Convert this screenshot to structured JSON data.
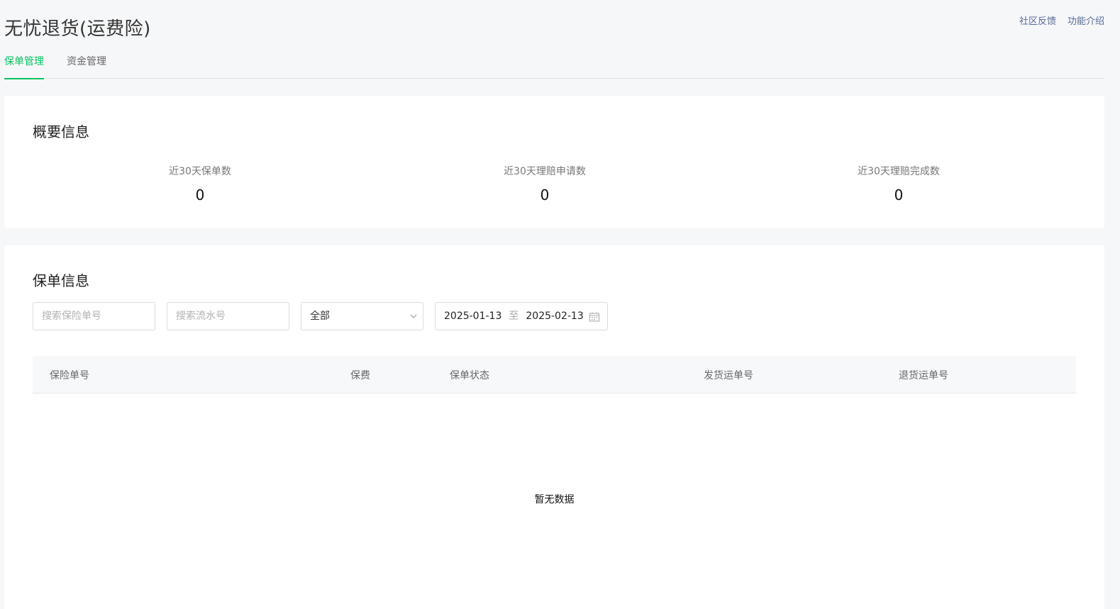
{
  "header": {
    "title": "无忧退货(运费险)",
    "links": [
      "社区反馈",
      "功能介绍"
    ]
  },
  "tabs": [
    {
      "label": "保单管理",
      "active": true
    },
    {
      "label": "资金管理",
      "active": false
    }
  ],
  "overview": {
    "title": "概要信息",
    "stats": [
      {
        "label": "近30天保单数",
        "value": "0"
      },
      {
        "label": "近30天理赔申请数",
        "value": "0"
      },
      {
        "label": "近30天理赔完成数",
        "value": "0"
      }
    ]
  },
  "policy": {
    "title": "保单信息",
    "filters": {
      "policy_no_placeholder": "搜索保险单号",
      "serial_no_placeholder": "搜索流水号",
      "status_selected": "全部",
      "date_start": "2025-01-13",
      "date_sep": "至",
      "date_end": "2025-02-13"
    },
    "table": {
      "columns": [
        "保险单号",
        "保费",
        "保单状态",
        "发货运单号",
        "退货运单号"
      ],
      "rows": [],
      "empty_text": "暂无数据"
    }
  },
  "colors": {
    "accent": "#07c160",
    "link": "#576b95",
    "background": "#f6f7f9"
  }
}
